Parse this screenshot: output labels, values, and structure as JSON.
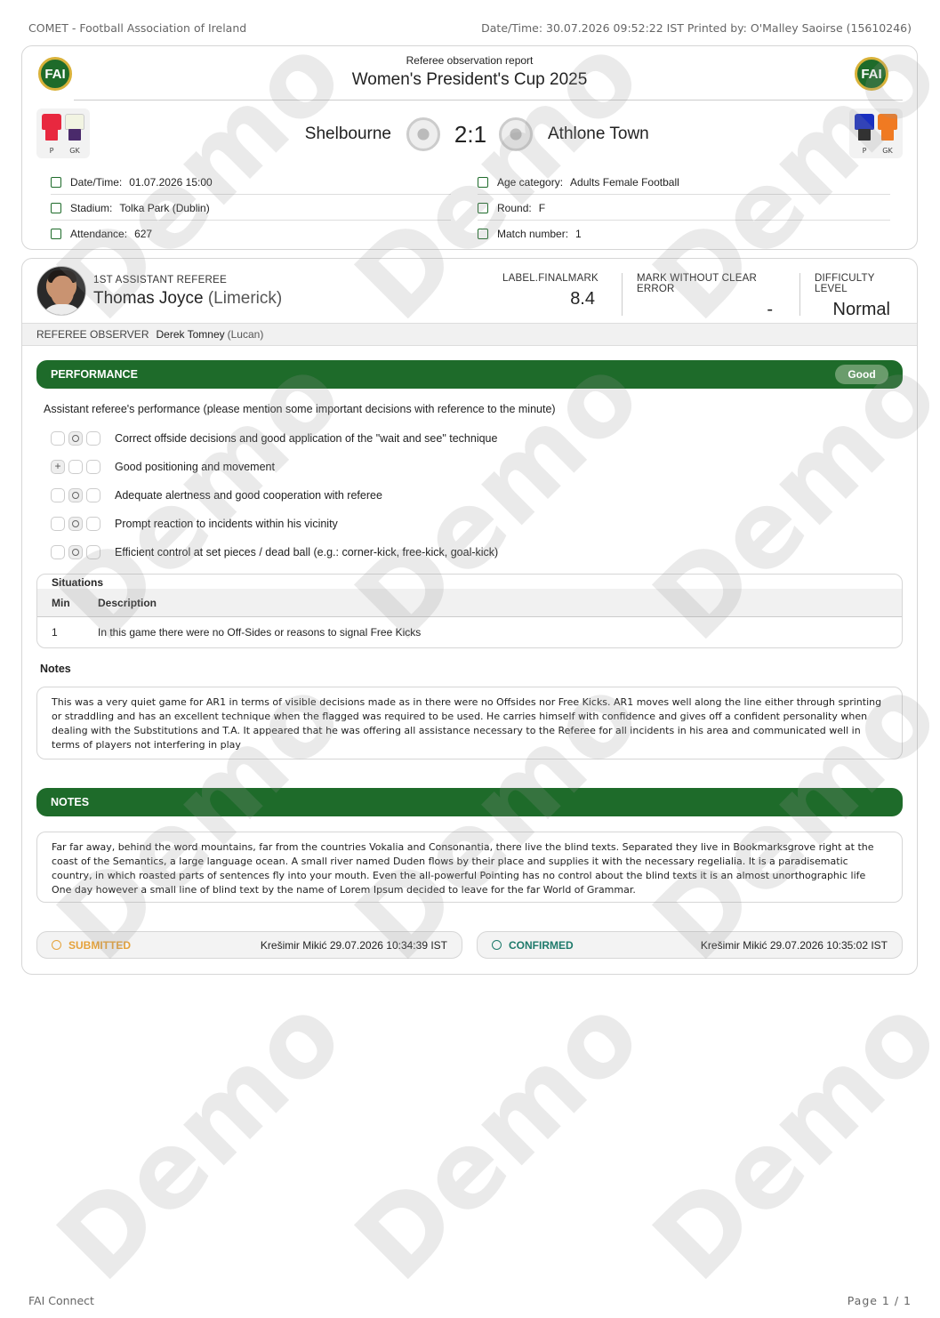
{
  "print_header": {
    "source": "COMET - Football Association of Ireland",
    "printed": "Date/Time: 30.07.2026 09:52:22 IST Printed by: O'Malley Saoirse (15610246)"
  },
  "match": {
    "logo_text": "FAI",
    "report_title": "Referee observation report",
    "competition": "Women's President's Cup 2025",
    "home_team": "Shelbourne",
    "away_team": "Athlone Town",
    "score": "2:1",
    "home_kit": {
      "player_label": "P",
      "gk_label": "GK",
      "player_shirt": "#e8283f",
      "player_shorts": "#e8283f",
      "gk_shirt": "#f2f4e2",
      "gk_shorts": "#4a2a6b"
    },
    "away_kit": {
      "player_label": "P",
      "gk_label": "GK",
      "player_shirt": "#1a2fc0",
      "player_shorts": "#1a1a1a",
      "gk_shirt": "#f07a22",
      "gk_shorts": "#f07a22"
    },
    "info_left": [
      {
        "icon": "calendar-icon",
        "label": "Date/Time:",
        "value": "01.07.2026 15:00"
      },
      {
        "icon": "stadium-icon",
        "label": "Stadium:",
        "value": "Tolka Park (Dublin)"
      },
      {
        "icon": "attendance-icon",
        "label": "Attendance:",
        "value": "627"
      }
    ],
    "info_right": [
      {
        "icon": "age-category-icon",
        "label": "Age category:",
        "value": "Adults Female Football"
      },
      {
        "icon": "trophy-icon",
        "label": "Round:",
        "value": "F"
      },
      {
        "icon": "match-number-icon",
        "label": "Match number:",
        "value": "1"
      }
    ]
  },
  "referee": {
    "role": "1ST ASSISTANT REFEREE",
    "name": "Thomas Joyce",
    "club": "(Limerick)",
    "final_mark_label": "LABEL.FINALMARK",
    "final_mark": "8.4",
    "mark_without_error_label": "MARK WITHOUT CLEAR ERROR",
    "mark_without_error": "-",
    "difficulty_label": "DIFFICULTY LEVEL",
    "difficulty": "Normal"
  },
  "observer": {
    "label": "REFEREE OBSERVER",
    "name": "Derek Tomney",
    "club": "(Lucan)"
  },
  "performance": {
    "title": "PERFORMANCE",
    "rating": "Good",
    "question": "Assistant referee's performance (please mention some important decisions with reference to the minute)",
    "criteria": [
      {
        "text": "Correct offside decisions and good application of the \"wait and see\" technique",
        "selected": 1
      },
      {
        "text": "Good positioning and movement",
        "selected": 0
      },
      {
        "text": "Adequate alertness and good cooperation with referee",
        "selected": 1
      },
      {
        "text": "Prompt reaction to incidents within his vicinity",
        "selected": 1
      },
      {
        "text": "Efficient control at set pieces / dead ball (e.g.: corner-kick, free-kick, goal-kick)",
        "selected": 1
      }
    ],
    "situations": {
      "caption": "Situations",
      "col_min": "Min",
      "col_desc": "Description",
      "rows": [
        {
          "min": "1",
          "description": "In this game there were no Off-Sides or reasons to signal Free Kicks"
        }
      ]
    },
    "notes_label": "Notes",
    "notes": "This was a very quiet game for AR1 in terms of visible decisions made as in there were no Offsides nor Free Kicks. AR1 moves well along the line either through sprinting or straddling and has an excellent technique when the flagged was required to be used. He carries himself with confidence and gives off a confident personality when dealing with the Substitutions and T.A. It appeared that he was offering all assistance necessary to the Referee for all incidents in his area and communicated well in terms of players not interfering in play"
  },
  "general_notes": {
    "title": "NOTES",
    "text": "Far far away, behind the word mountains, far from the countries Vokalia and Consonantia, there live the blind texts. Separated they live in Bookmarksgrove right at the coast of the Semantics, a large language ocean. A small river named Duden flows by their place and supplies it with the necessary regelialia. It is a paradisematic country, in which roasted parts of sentences fly into your mouth. Even the all-powerful Pointing has no control about the blind texts it is an almost unorthographic life One day however a small line of blind text by the name of Lorem Ipsum decided to leave for the far World of Grammar."
  },
  "status": {
    "submitted_label": "SUBMITTED",
    "submitted_by": "Krešimir Mikić 29.07.2026 10:34:39 IST",
    "confirmed_label": "CONFIRMED",
    "confirmed_by": "Krešimir Mikić 29.07.2026 10:35:02 IST"
  },
  "watermark": "Demo",
  "footer": {
    "left": "FAI Connect",
    "page": "Page   1   /   1"
  },
  "colors": {
    "brand_green": "#1e6b2a",
    "submitted": "#e5a23a",
    "confirmed": "#1e7a6b"
  }
}
